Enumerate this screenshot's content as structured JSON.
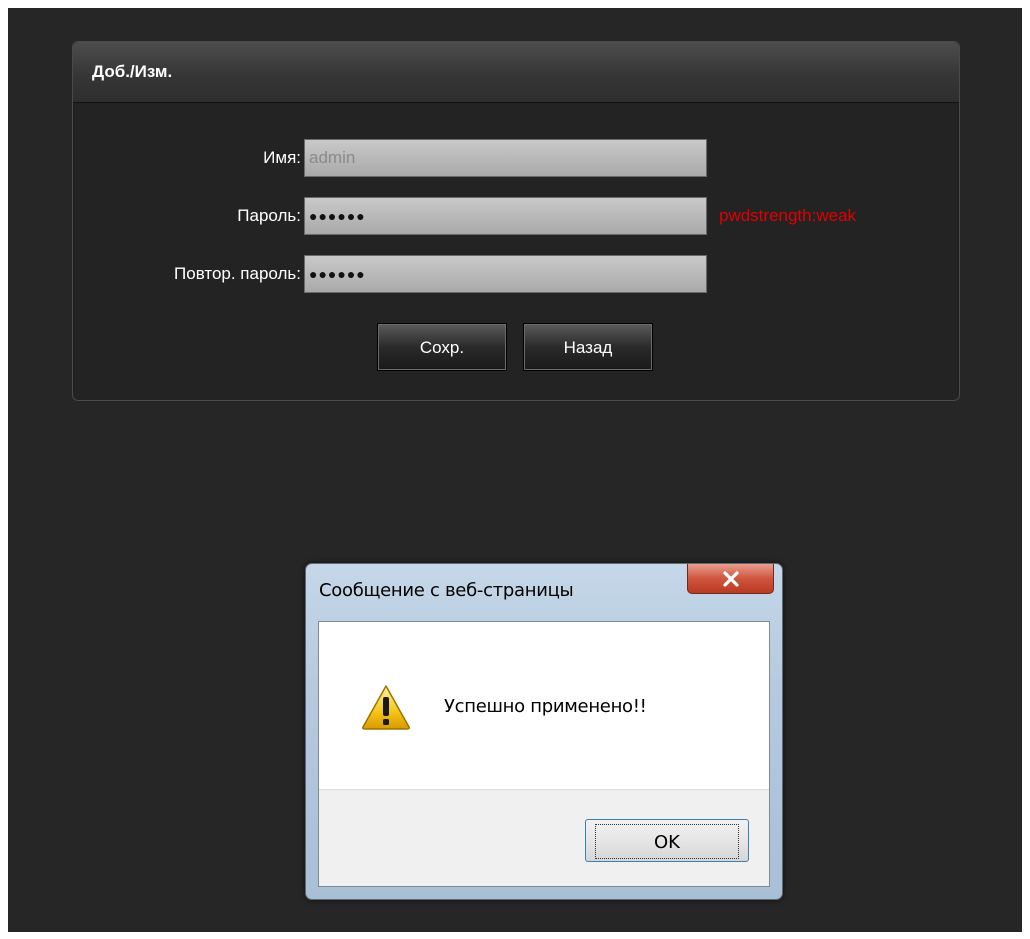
{
  "panel": {
    "title": "Доб./Изм.",
    "fields": {
      "name": {
        "label": "Имя:",
        "value": "admin"
      },
      "password": {
        "label": "Пароль:",
        "value": "●●●●●●"
      },
      "repeat": {
        "label": "Повтор. пароль:",
        "value": "●●●●●●"
      }
    },
    "strength_text": "pwdstrength:weak",
    "save_label": "Сохр.",
    "back_label": "Назад"
  },
  "dialog": {
    "title": "Сообщение с веб-страницы",
    "message": "Успешно применено!!",
    "ok_label": "OK",
    "icon": "warning-icon"
  },
  "colors": {
    "page_bg": "#262626",
    "strength": "#e00000"
  }
}
